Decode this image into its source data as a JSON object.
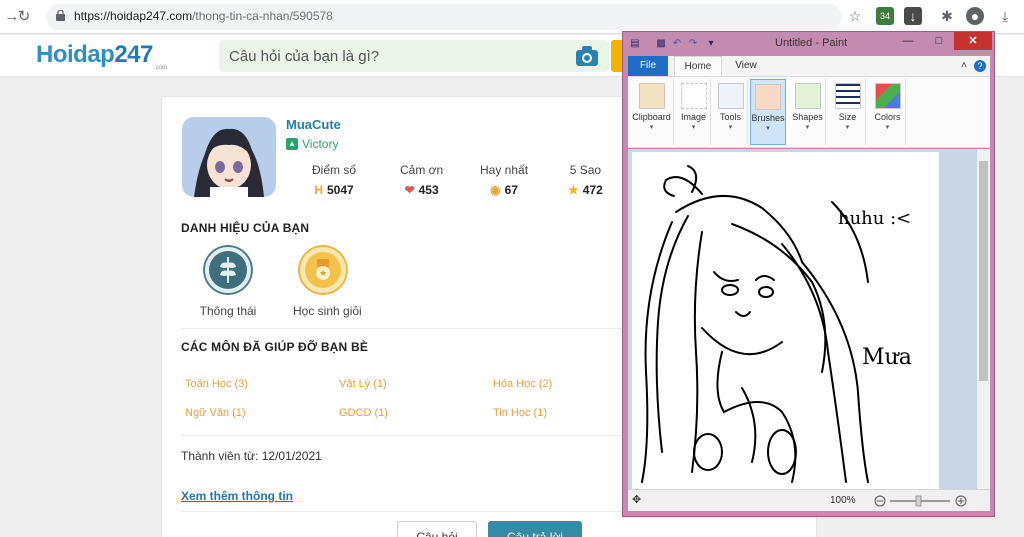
{
  "browser": {
    "url_host": "https://hoidap247.com",
    "url_path": "/thong-tin-ca-nhan/590578",
    "extension_badge": "34"
  },
  "site": {
    "logo_main": "Hoidap",
    "logo_num": "247",
    "logo_sub": ".com",
    "search_placeholder": "Câu hỏi của bạn là gì?"
  },
  "profile": {
    "username": "MuaCute",
    "rank": "Victory",
    "stats": [
      {
        "label": "Điểm số",
        "value": "5047",
        "icon": "h-coin-icon",
        "color": "#e9a93a"
      },
      {
        "label": "Cảm ơn",
        "value": "453",
        "icon": "heart-icon",
        "color": "#e05555"
      },
      {
        "label": "Hay nhất",
        "value": "67",
        "icon": "medal-icon",
        "color": "#e8a52c"
      },
      {
        "label": "5 Sao",
        "value": "472",
        "icon": "star-icon",
        "color": "#f0b324"
      }
    ],
    "titles_heading": "DANH HIỆU CỦA BẠN",
    "badges": [
      {
        "label": "Thông thái",
        "icon": "wheat-icon"
      },
      {
        "label": "Học sinh giỏi",
        "icon": "gold-medal-icon"
      }
    ],
    "subjects_heading": "CÁC MÔN ĐÃ GIÚP ĐỠ BẠN BÈ",
    "subjects": [
      "Toán Học (3)",
      "Vật Lý (1)",
      "Hóa Học (2)",
      "Ngữ Văn (1)",
      "GDCD (1)",
      "Tin Học (1)"
    ],
    "member_since": "Thành viên từ: 12/01/2021",
    "more_link": "Xem thêm thông tin",
    "btn_questions": "Câu hỏi",
    "btn_answers": "Câu trả lời"
  },
  "paint": {
    "title": "Untitled - Paint",
    "menu_file": "File",
    "tab_home": "Home",
    "tab_view": "View",
    "groups": [
      "Clipboard",
      "Image",
      "Tools",
      "Brushes",
      "Shapes",
      "Size",
      "Colors"
    ],
    "zoom": "100%",
    "drawing_text_1": "huhu :<",
    "drawing_text_2": "Mưa"
  }
}
